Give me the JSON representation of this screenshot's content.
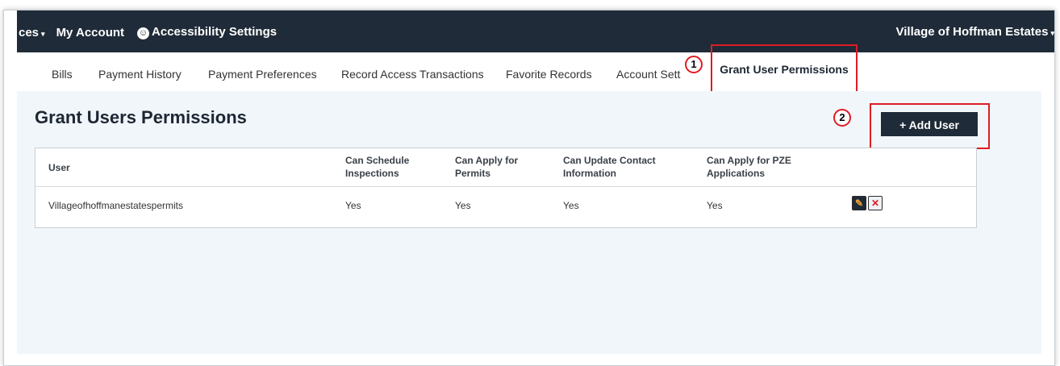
{
  "topbar": {
    "services_label": "ces",
    "my_account_label": "My Account",
    "accessibility_label": "Accessibility Settings",
    "municipality": "Village of Hoffman Estates"
  },
  "tabs": [
    {
      "label": "Bills"
    },
    {
      "label": "Payment History"
    },
    {
      "label": "Payment Preferences"
    },
    {
      "label": "Record Access Transactions"
    },
    {
      "label": "Favorite Records"
    },
    {
      "label": "Account Sett"
    },
    {
      "label": "Grant User Permissions"
    }
  ],
  "markers": {
    "one": "1",
    "two": "2"
  },
  "page": {
    "title": "Grant Users Permissions",
    "add_user_label": "+ Add User"
  },
  "table": {
    "headers": {
      "user": "User",
      "schedule": [
        "Can Schedule",
        "Inspections"
      ],
      "permits": [
        "Can Apply for",
        "Permits"
      ],
      "contact": [
        "Can Update Contact",
        "Information"
      ],
      "pze": [
        "Can Apply for PZE",
        "Applications"
      ]
    },
    "rows": [
      {
        "user": "Villageofhoffmanestatespermits",
        "schedule": "Yes",
        "permits": "Yes",
        "contact": "Yes",
        "pze": "Yes"
      }
    ]
  },
  "colors": {
    "topbar": "#1f2b38",
    "highlight": "#e01b24",
    "edit_icon": "#f0a030",
    "delete_icon": "#e01b24"
  },
  "icons": {
    "edit": "pencil-icon",
    "delete": "delete-x-icon",
    "accessibility": "accessibility-icon"
  }
}
